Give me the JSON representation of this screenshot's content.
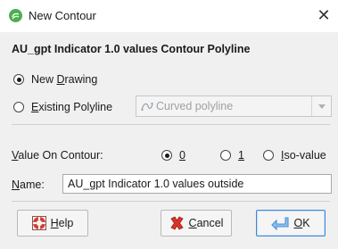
{
  "window": {
    "title": "New Contour",
    "title_icon": "contour-app-icon",
    "close_label": "✕"
  },
  "dialog": {
    "heading": "AU_gpt Indicator 1.0 values Contour Polyline",
    "source_options": [
      {
        "pre": "New ",
        "mnemonic": "D",
        "post": "rawing",
        "selected": true
      },
      {
        "pre": "",
        "mnemonic": "E",
        "post": "xisting Polyline",
        "selected": false
      }
    ],
    "existing_polyline": {
      "value": "Curved polyline",
      "icon": "curved-polyline-icon",
      "enabled": false
    },
    "value_on_contour": {
      "label_mnemonic": "V",
      "label_rest": "alue On Contour:",
      "options": [
        {
          "mnemonic": "0",
          "rest": "",
          "selected": true
        },
        {
          "mnemonic": "1",
          "rest": "",
          "selected": false
        },
        {
          "mnemonic": "I",
          "rest": "so-value",
          "selected": false
        }
      ]
    },
    "name": {
      "label_mnemonic": "N",
      "label_rest": "ame:",
      "value": "AU_gpt Indicator 1.0 values outside"
    }
  },
  "buttons": {
    "help": {
      "mnemonic": "H",
      "rest": "elp",
      "icon": "help-lifebuoy-icon"
    },
    "cancel": {
      "mnemonic": "C",
      "rest": "ancel",
      "icon": "cancel-x-icon"
    },
    "ok": {
      "mnemonic": "O",
      "rest": "K",
      "icon": "ok-return-arrow-icon"
    }
  },
  "colors": {
    "title_icon_green": "#4caf50",
    "ok_border": "#3c8ad6",
    "cancel_red": "#d9342b",
    "help_red": "#d23b2f",
    "ok_blue": "#4a90d9"
  }
}
